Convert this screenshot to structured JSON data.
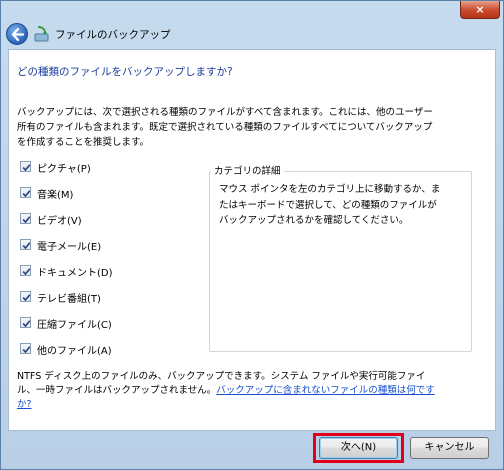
{
  "window": {
    "title": "ファイルのバックアップ",
    "close_label": "×"
  },
  "main": {
    "question": "どの種類のファイルをバックアップしますか?",
    "intro_lines": [
      "バックアップには、次で選択される種類のファイルがすべて含まれます。これには、他のユーザー",
      "所有のファイルも含まれます。既定で選択されている種類のファイルすべてについてバックアップ",
      "を作成することを推奨します。"
    ],
    "categories": [
      {
        "label": "ピクチャ(P)",
        "checked": true
      },
      {
        "label": "音楽(M)",
        "checked": true
      },
      {
        "label": "ビデオ(V)",
        "checked": true
      },
      {
        "label": "電子メール(E)",
        "checked": true
      },
      {
        "label": "ドキュメント(D)",
        "checked": true
      },
      {
        "label": "テレビ番組(T)",
        "checked": true
      },
      {
        "label": "圧縮ファイル(C)",
        "checked": true
      },
      {
        "label": "他のファイル(A)",
        "checked": true
      }
    ],
    "details": {
      "legend": "カテゴリの詳細",
      "lines": [
        "マウス ポインタを左のカテゴリ上に移動するか、ま",
        "たはキーボードで選択して、どの種類のファイルが",
        "バックアップされるかを確認してください。"
      ]
    },
    "footer": {
      "line1": "NTFS ディスク上のファイルのみ、バックアップできます。システム ファイルや実行可能ファイ",
      "line2_prefix": "ル、一時ファイルはバックアップされません。",
      "link_part1": "バックアップに含まれないファイルの種類は何です",
      "link_part2": "か?"
    }
  },
  "buttons": {
    "next": "次へ(N)",
    "cancel": "キャンセル"
  },
  "colors": {
    "accent_text": "#1a3d9c",
    "link": "#1a4fd0",
    "highlight_border": "#e0001b"
  }
}
